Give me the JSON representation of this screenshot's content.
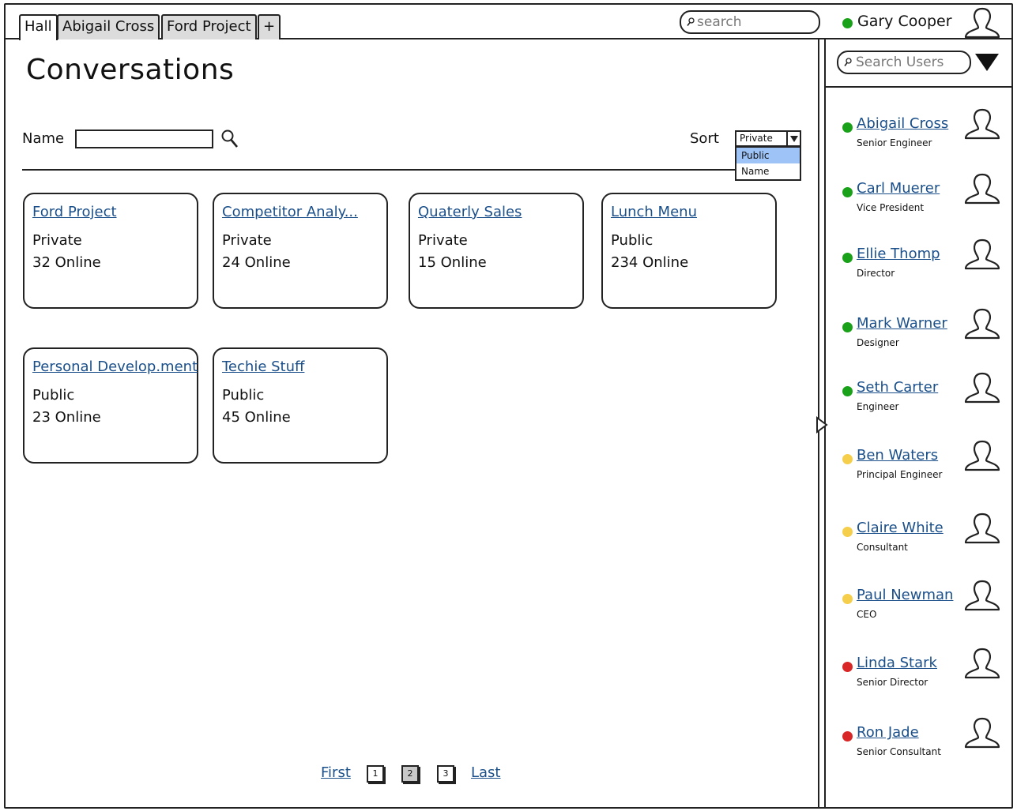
{
  "tabs": [
    {
      "label": "Hall",
      "active": true
    },
    {
      "label": "Abigail Cross",
      "active": false
    },
    {
      "label": "Ford Project",
      "active": false
    },
    {
      "label": "+",
      "active": false
    }
  ],
  "header": {
    "search_placeholder": "search",
    "current_user": {
      "name": "Gary Cooper",
      "status": "online",
      "status_color": "#1aa11a"
    }
  },
  "main": {
    "title": "Conversations",
    "filter": {
      "name_label": "Name",
      "name_value": "",
      "sort_label": "Sort",
      "sort_selected": "Private",
      "sort_options": [
        "Public",
        "Name"
      ],
      "sort_highlighted": "Public"
    },
    "cards": [
      {
        "title": "Ford Project",
        "type": "Private",
        "online": "32 Online"
      },
      {
        "title": "Competitor Analy...",
        "type": "Private",
        "online": "24 Online"
      },
      {
        "title": "Quaterly Sales",
        "type": "Private",
        "online": "15 Online"
      },
      {
        "title": "Lunch Menu",
        "type": "Public",
        "online": "234 Online"
      },
      {
        "title": "Personal Develop.ment",
        "type": "Public",
        "online": "23 Online"
      },
      {
        "title": "Techie Stuff",
        "type": "Public",
        "online": "45 Online"
      }
    ],
    "pagination": {
      "first": "First",
      "pages": [
        "1",
        "2",
        "3"
      ],
      "current": "2",
      "last": "Last"
    }
  },
  "sidebar": {
    "search_placeholder": "Search Users",
    "status_colors": {
      "online": "#1aa11a",
      "away": "#f5cf4b",
      "busy": "#d92626"
    },
    "users": [
      {
        "name": "Abigail Cross",
        "role": "Senior Engineer",
        "status": "online"
      },
      {
        "name": "Carl Muerer",
        "role": "Vice President",
        "status": "online"
      },
      {
        "name": "Ellie Thomp",
        "role": "Director",
        "status": "online"
      },
      {
        "name": "Mark Warner",
        "role": "Designer",
        "status": "online"
      },
      {
        "name": "Seth Carter",
        "role": "Engineer",
        "status": "online"
      },
      {
        "name": "Ben Waters",
        "role": "Principal Engineer",
        "status": "away"
      },
      {
        "name": "Claire White",
        "role": "Consultant",
        "status": "away"
      },
      {
        "name": "Paul Newman",
        "role": "CEO",
        "status": "away"
      },
      {
        "name": "Linda Stark",
        "role": "Senior Director",
        "status": "busy"
      },
      {
        "name": "Ron Jade",
        "role": "Senior Consultant",
        "status": "busy"
      }
    ]
  }
}
